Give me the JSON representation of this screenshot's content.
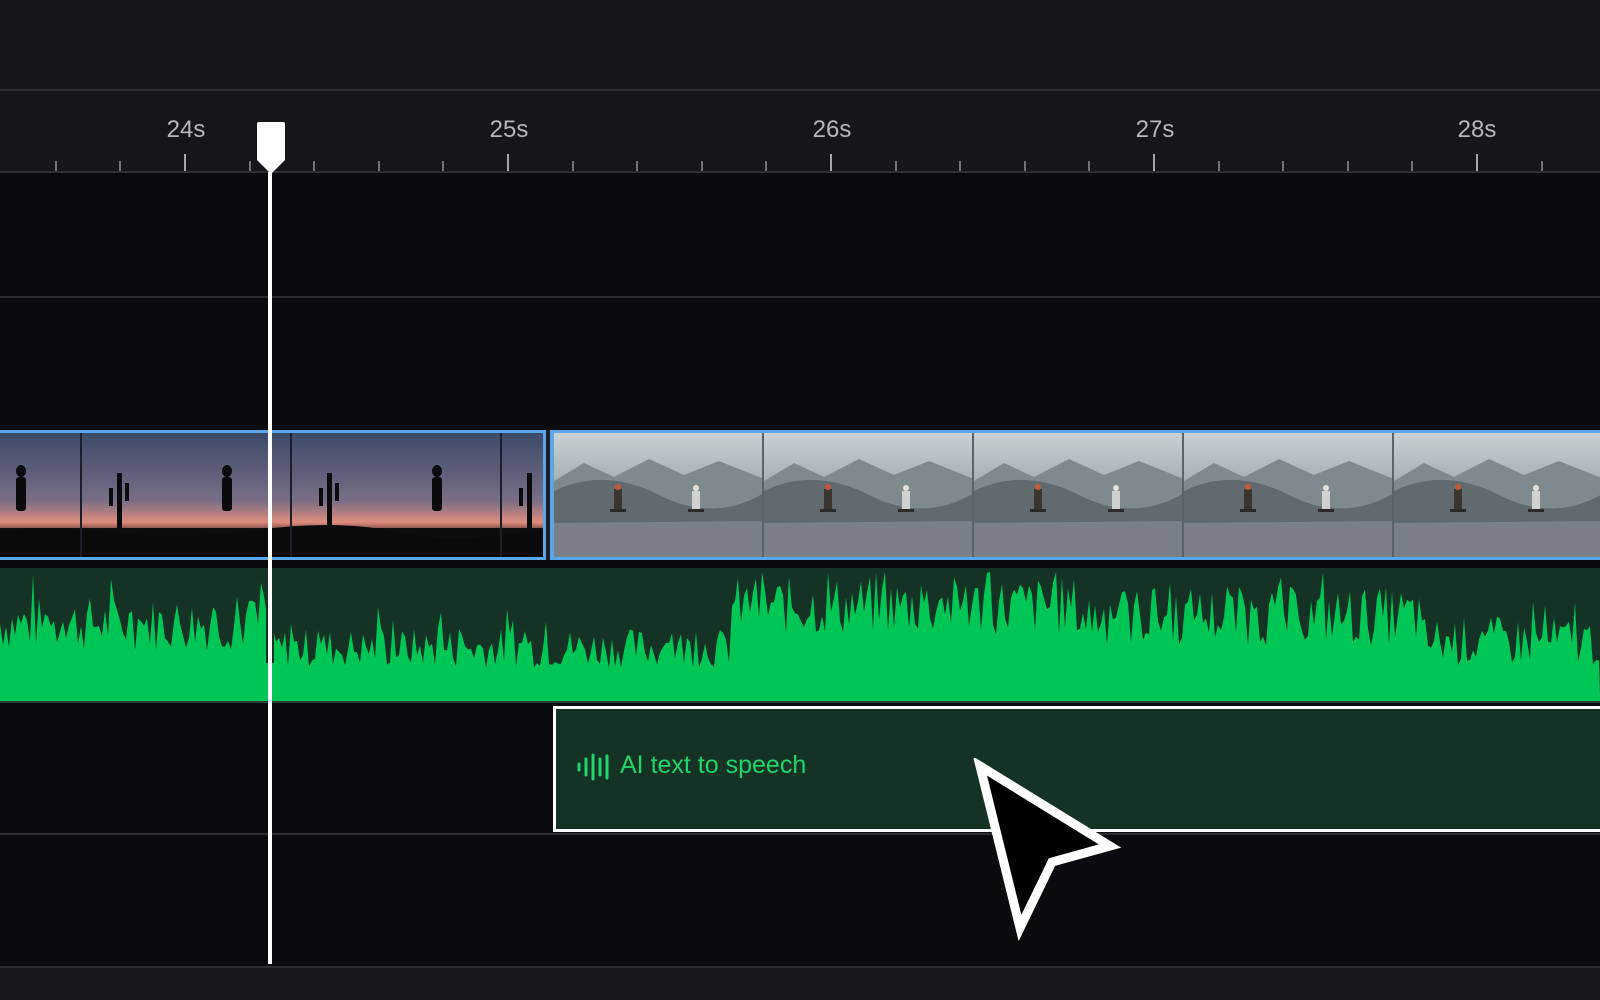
{
  "timeline": {
    "ruler": {
      "labels": [
        "24s",
        "25s",
        "26s",
        "27s",
        "28s"
      ]
    },
    "playhead": {
      "time": "24.26s"
    },
    "video_track": {
      "clips": [
        {
          "name": "sunset-silhouette-clip",
          "frames": 3
        },
        {
          "name": "mountain-skateboard-clip",
          "frames": 5
        }
      ]
    },
    "audio_track": {
      "color": "#00c656",
      "background": "#153324"
    },
    "tts_clip": {
      "label": "AI text to speech",
      "color": "#1fd46a"
    },
    "colors": {
      "clip_border": "#5aa6ea",
      "background": "#0a0b0e",
      "panel": "#151619"
    },
    "icons": {
      "playhead": "playhead-marker-icon",
      "tts": "waveform-icon",
      "cursor": "mouse-pointer-icon"
    }
  }
}
